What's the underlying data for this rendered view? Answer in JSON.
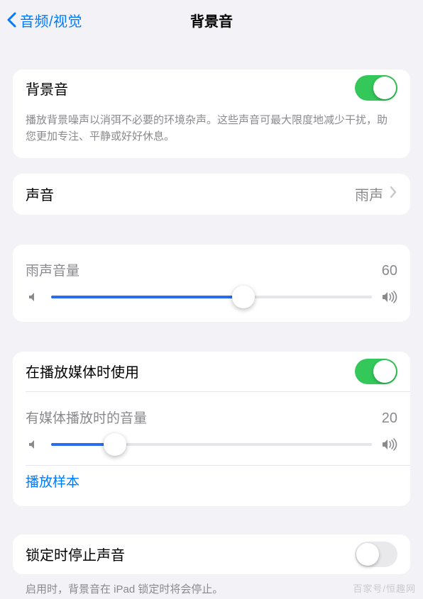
{
  "nav": {
    "back_label": "音频/视觉",
    "title": "背景音"
  },
  "section1": {
    "toggle_label": "背景音",
    "toggle_on": true,
    "footer": "播放背景噪声以消弭不必要的环境杂声。这些声音可最大限度地减少干扰，助您更加专注、平静或好好休息。"
  },
  "section2": {
    "label": "声音",
    "value": "雨声"
  },
  "section3": {
    "label": "雨声音量",
    "value": "60",
    "percent": 60
  },
  "section4": {
    "toggle_label": "在播放媒体时使用",
    "toggle_on": true,
    "slider_label": "有媒体播放时的音量",
    "slider_value": "20",
    "slider_percent": 20,
    "link": "播放样本"
  },
  "section5": {
    "toggle_label": "锁定时停止声音",
    "toggle_on": false,
    "footer": "启用时，背景音在 iPad 锁定时将会停止。"
  },
  "watermark": "百家号/恒趣网"
}
